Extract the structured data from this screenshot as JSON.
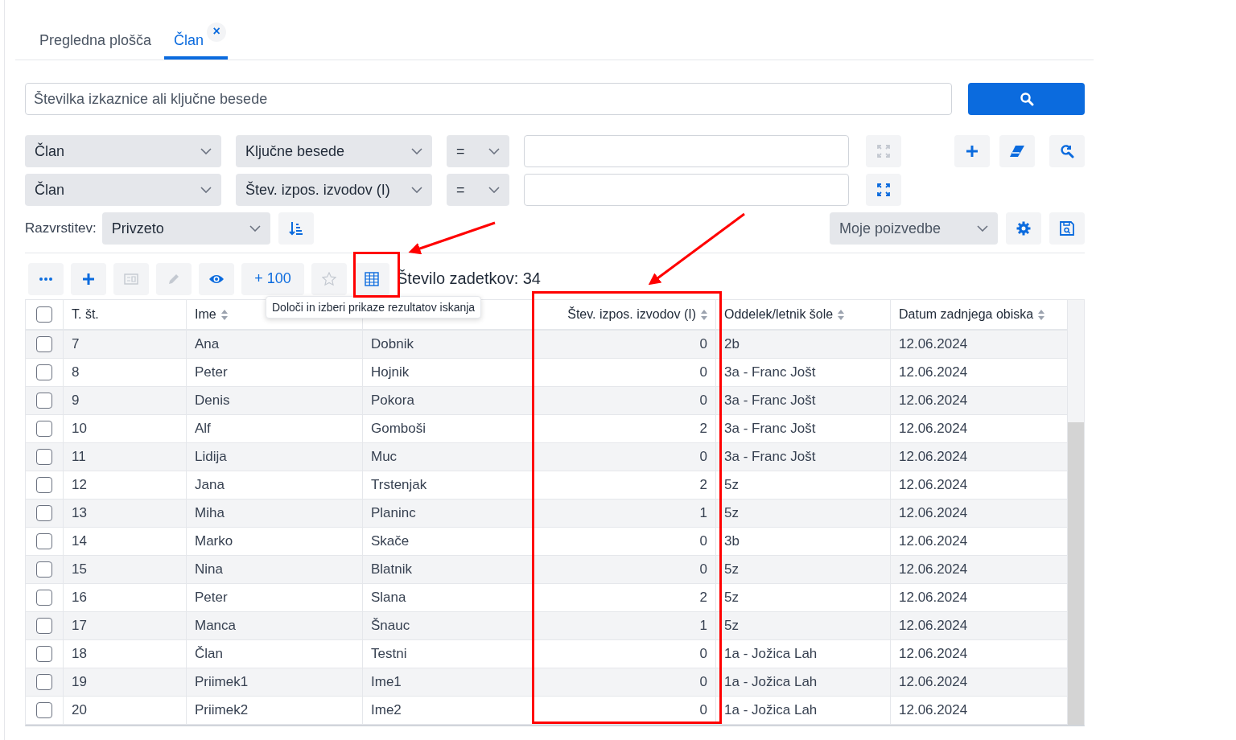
{
  "tabs": [
    {
      "label": "Pregledna plošča",
      "selected": false,
      "closable": false
    },
    {
      "label": "Član",
      "selected": true,
      "closable": true,
      "close": "×"
    }
  ],
  "search": {
    "placeholder": "Številka izkaznice ali ključne besede"
  },
  "filters": [
    {
      "field": "Član",
      "attribute": "Ključne besede",
      "operator": "=",
      "expand_disabled": true
    },
    {
      "field": "Član",
      "attribute": "Štev. izpos. izvodov (I)",
      "operator": "="
    }
  ],
  "sort": {
    "label": "Razvrstitev:",
    "value": "Privzeto"
  },
  "queries": {
    "value": "Moje poizvedbe"
  },
  "toolbar": [
    {
      "kind": "more",
      "disabled": false
    },
    {
      "kind": "add",
      "disabled": false
    },
    {
      "kind": "card",
      "disabled": true
    },
    {
      "kind": "edit",
      "disabled": true
    },
    {
      "kind": "view",
      "disabled": false
    },
    {
      "kind": "text",
      "label": "+ 100",
      "disabled": false
    },
    {
      "kind": "star",
      "disabled": true
    },
    {
      "kind": "columns",
      "disabled": false
    }
  ],
  "result_count": "Število zadetkov: 34",
  "tooltip": "Določi in izberi prikaze rezultatov iskanja",
  "table": {
    "header_checked": false,
    "columns": [
      {
        "label": "T. št.",
        "sortable": false
      },
      {
        "label": "Ime",
        "sortable": true
      },
      {},
      {
        "label": "Štev. izpos. izvodov (I)",
        "sortable": true,
        "numeric": true
      },
      {
        "label": "Oddelek/letnik šole",
        "sortable": true
      },
      {
        "label": "Datum zadnjega obiska",
        "sortable": true
      }
    ],
    "rows": [
      {
        "checked": false,
        "cells": [
          "7",
          "Ana",
          "Dobnik",
          "0",
          "2b",
          "12.06.2024"
        ]
      },
      {
        "checked": false,
        "cells": [
          "8",
          "Peter",
          "Hojnik",
          "0",
          "3a - Franc Jošt",
          "12.06.2024"
        ]
      },
      {
        "checked": false,
        "cells": [
          "9",
          "Denis",
          "Pokora",
          "0",
          "3a - Franc Jošt",
          "12.06.2024"
        ]
      },
      {
        "checked": false,
        "cells": [
          "10",
          "Alf",
          "Gomboši",
          "2",
          "3a - Franc Jošt",
          "12.06.2024"
        ]
      },
      {
        "checked": false,
        "cells": [
          "11",
          "Lidija",
          "Muc",
          "0",
          "3a - Franc Jošt",
          "12.06.2024"
        ]
      },
      {
        "checked": false,
        "cells": [
          "12",
          "Jana",
          "Trstenjak",
          "2",
          "5z",
          "12.06.2024"
        ]
      },
      {
        "checked": false,
        "cells": [
          "13",
          "Miha",
          "Planinc",
          "1",
          "5z",
          "12.06.2024"
        ]
      },
      {
        "checked": false,
        "cells": [
          "14",
          "Marko",
          "Skače",
          "0",
          "3b",
          "12.06.2024"
        ]
      },
      {
        "checked": false,
        "cells": [
          "15",
          "Nina",
          "Blatnik",
          "0",
          "5z",
          "12.06.2024"
        ]
      },
      {
        "checked": false,
        "cells": [
          "16",
          "Peter",
          "Slana",
          "2",
          "5z",
          "12.06.2024"
        ]
      },
      {
        "checked": false,
        "cells": [
          "17",
          "Manca",
          "Šnauc",
          "1",
          "5z",
          "12.06.2024"
        ]
      },
      {
        "checked": false,
        "cells": [
          "18",
          "Član",
          "Testni",
          "0",
          "1a - Jožica Lah",
          "12.06.2024"
        ]
      },
      {
        "checked": false,
        "cells": [
          "19",
          "Priimek1",
          "Ime1",
          "0",
          "1a - Jožica Lah",
          "12.06.2024"
        ]
      },
      {
        "checked": false,
        "cells": [
          "20",
          "Priimek2",
          "Ime2",
          "0",
          "1a - Jožica Lah",
          "12.06.2024"
        ]
      }
    ]
  }
}
